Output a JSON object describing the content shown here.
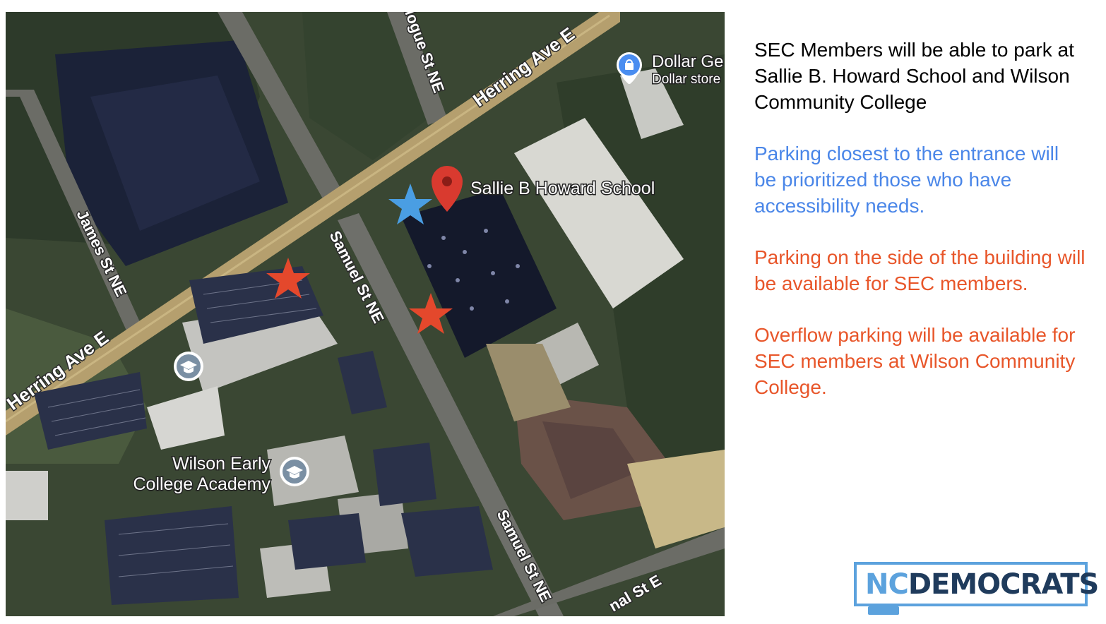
{
  "map": {
    "roads": {
      "herring_upper": "Herring Ave E",
      "herring_lower": "Herring Ave E",
      "james": "James St NE",
      "samuel_upper": "Samuel St NE",
      "samuel_lower": "Samuel St NE",
      "hogue": "logue St NE",
      "nal": "nal St E"
    },
    "places": {
      "sallie": "Sallie B Howard School",
      "dollar_name": "Dollar Ge",
      "dollar_type": "Dollar store",
      "wilson_line1": "Wilson Early",
      "wilson_line2": "College Academy"
    },
    "markers": {
      "red_pin": "location-pin-icon",
      "blue_star": "accessible-parking-star",
      "red_stars": "sec-parking-star",
      "school_icon": "graduation-cap-icon",
      "store_icon": "shopping-bag-icon"
    },
    "colors": {
      "blue_star": "#4a9ee3",
      "red_star": "#e4482c",
      "pin": "#d93a2f"
    }
  },
  "notes": {
    "intro": "SEC Members will be able to park at Sallie B. Howard School and Wilson Community College",
    "accessibility": "Parking closest to the entrance will be prioritized those who have accessibility needs.",
    "side": "Parking on the side of the building will be available for SEC members.",
    "overflow": "Overflow parking will be available for SEC members at Wilson Community College."
  },
  "logo": {
    "nc": "NC",
    "democrats": "DEMOCRATS"
  },
  "colors": {
    "intro": "#000000",
    "blue": "#4a86e8",
    "orange": "#e8562a",
    "logo_light": "#5ca2dd",
    "logo_dark": "#1f3b5c"
  }
}
